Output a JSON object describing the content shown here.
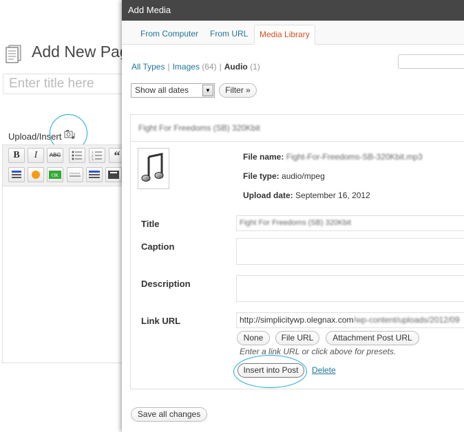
{
  "colors": {
    "accent": "#21759b",
    "active_tab": "#d54e21",
    "highlight_circle": "#19a9d5",
    "modal_header": "#464646"
  },
  "background": {
    "page_title": "Add New Page",
    "title_placeholder": "Enter title here",
    "upload_label": "Upload/Insert",
    "upload_icon": "camera-music-icon",
    "toolbar": [
      "B",
      "I",
      "ABC",
      "bullet-list",
      "numbered-list",
      "quote"
    ]
  },
  "modal": {
    "title": "Add Media",
    "tabs": [
      {
        "label": "From Computer"
      },
      {
        "label": "From URL"
      },
      {
        "label": "Media Library"
      }
    ],
    "filters": {
      "all": "All Types",
      "images": "Images",
      "images_count": "(64)",
      "audio": "Audio",
      "audio_count": "(1)"
    },
    "date_select": "Show all dates",
    "filter_button": "Filter »",
    "item": {
      "header_name": "Fight For Freedoms (SB) 320Kbit",
      "file_name_label": "File name:",
      "file_name_value": "Fight-For-Freedoms-SB-320Kbit.mp3",
      "file_type_label": "File type:",
      "file_type_value": "audio/mpeg",
      "upload_date_label": "Upload date:",
      "upload_date_value": "September 16, 2012"
    },
    "fields": {
      "title_label": "Title",
      "title_value": "Fight For Freedoms (SB) 320Kbit",
      "caption_label": "Caption",
      "description_label": "Description",
      "link_url_label": "Link URL",
      "link_url_value": "http://simplicitywp.olegnax.com",
      "link_url_blur": "/wp-content/uploads/2012/09"
    },
    "link_buttons": [
      "None",
      "File URL",
      "Attachment Post URL"
    ],
    "hint": "Enter a link URL or click above for presets.",
    "insert_button": "Insert into Post",
    "delete_link": "Delete",
    "save_button": "Save all changes"
  }
}
